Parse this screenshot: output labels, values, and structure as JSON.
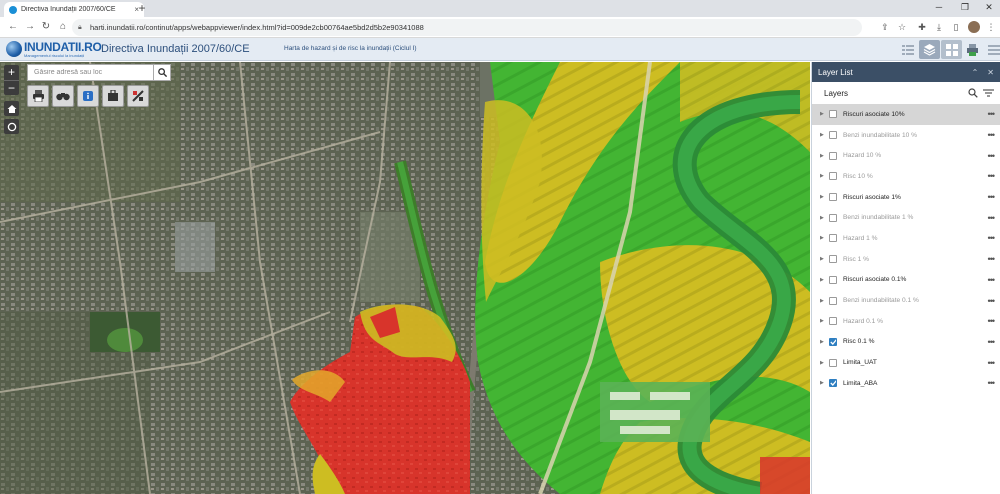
{
  "browser": {
    "tab_title": "Directiva Inundații 2007/60/CE",
    "close_glyph": "×",
    "newtab_glyph": "+",
    "url": "harti.inundatii.ro/continut/apps/webappviewer/index.html?id=009de2cb00764ae5bd2d5b2e90341088",
    "icons": [
      "back-icon",
      "forward-icon",
      "reload-icon",
      "home-icon",
      "lock-icon",
      "share-icon",
      "star-icon",
      "extension-icon",
      "download-icon",
      "sidepanel-icon",
      "profile-avatar",
      "menu-icon"
    ]
  },
  "header": {
    "logo_text": "INUNDATII.RO",
    "logo_subtitle": "Managementul riscului la inundații",
    "title": "Directiva Inundații 2007/60/CE",
    "subtitle": "Harta de hazard și de risc la inundații (Ciclul I)",
    "buttons": [
      "legend-icon",
      "layer-list-icon",
      "basemap-gallery-icon",
      "print-icon",
      "more-icon"
    ]
  },
  "map": {
    "search_placeholder": "Găsire adresă sau loc",
    "zoom_in": "+",
    "zoom_out": "−",
    "tools": [
      "print-icon",
      "binoculars-icon",
      "info-icon",
      "bookmark-icon",
      "measure-icon"
    ]
  },
  "layer_panel": {
    "title": "Layer List",
    "section_label": "Layers",
    "layers": [
      {
        "name": "Riscuri asociate 10%",
        "checked": false,
        "visible": true,
        "highlighted": true
      },
      {
        "name": "Benzi inundabilitate 10 %",
        "checked": false,
        "visible": false,
        "highlighted": false
      },
      {
        "name": "Hazard 10 %",
        "checked": false,
        "visible": false,
        "highlighted": false
      },
      {
        "name": "Risc 10 %",
        "checked": false,
        "visible": false,
        "highlighted": false
      },
      {
        "name": "Riscuri asociate 1%",
        "checked": false,
        "visible": true,
        "highlighted": false
      },
      {
        "name": "Benzi inundabilitate 1 %",
        "checked": false,
        "visible": false,
        "highlighted": false
      },
      {
        "name": "Hazard 1 %",
        "checked": false,
        "visible": false,
        "highlighted": false
      },
      {
        "name": "Risc 1 %",
        "checked": false,
        "visible": false,
        "highlighted": false
      },
      {
        "name": "Riscuri asociate 0.1%",
        "checked": false,
        "visible": true,
        "highlighted": false
      },
      {
        "name": "Benzi inundabilitate 0.1 %",
        "checked": false,
        "visible": false,
        "highlighted": false
      },
      {
        "name": "Hazard 0.1 %",
        "checked": false,
        "visible": false,
        "highlighted": false
      },
      {
        "name": "Risc 0.1 %",
        "checked": true,
        "visible": true,
        "highlighted": false
      },
      {
        "name": "Limita_UAT",
        "checked": false,
        "visible": true,
        "highlighted": false
      },
      {
        "name": "Limita_ABA",
        "checked": true,
        "visible": true,
        "highlighted": false
      }
    ]
  },
  "colors": {
    "risk_high": "#d9342b",
    "risk_medium": "#d4c21e",
    "risk_low": "#3fb830",
    "header_bg": "#e4ebf3",
    "panel_header": "#3b4f66",
    "checkbox_on": "#2f7fc1"
  }
}
